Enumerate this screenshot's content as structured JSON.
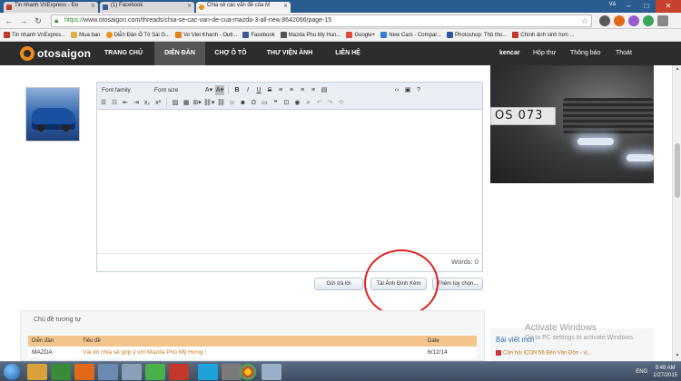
{
  "browser": {
    "tabs": [
      {
        "label": "Tin nhanh VnExpress - Đọ",
        "favicon_color": "#c0392b",
        "active": false
      },
      {
        "label": "(1) Facebook",
        "favicon_color": "#3b5998",
        "active": false
      },
      {
        "label": "Chia sẻ các vấn đề của M",
        "favicon_color": "#f08b1a",
        "active": true
      }
    ],
    "user_label": "Vá",
    "url_scheme": "https://",
    "url_rest": "www.otosaigon.com/threads/chia-se-cac-van-de-cua-mazda-3-all-new.8642066/page-15",
    "bookmarks": [
      {
        "label": "Tin nhanh VnExpres...",
        "color": "#c0392b"
      },
      {
        "label": "Mua ban",
        "color": "#e0b04a"
      },
      {
        "label": "Diễn Đàn Ô Tô Sài G...",
        "color": "#f08b1a"
      },
      {
        "label": "Vo Viet Khanh - Outl...",
        "color": "#e67e22"
      },
      {
        "label": "Facebook",
        "color": "#3b5998"
      },
      {
        "label": "Mazda Phu My Hun...",
        "color": "#555555"
      },
      {
        "label": "Google+",
        "color": "#dd4b39"
      },
      {
        "label": "New Cars - Compar...",
        "color": "#3a7bd5"
      },
      {
        "label": "Photoshop: Thủ thu...",
        "color": "#2c5aa0"
      },
      {
        "label": "Chính ảnh sinh hơn ...",
        "color": "#c0392b"
      }
    ]
  },
  "site": {
    "logo_text": "otosaigon",
    "nav": [
      "TRANG CHỦ",
      "DIỄN ĐÀN",
      "CHỢ Ô TÔ",
      "THƯ VIỆN ẢNH",
      "LIÊN HỆ"
    ],
    "active_nav": "DIỄN ĐÀN",
    "username": "kencar",
    "inbox": "Hộp thư",
    "alerts": "Thông báo",
    "logout": "Thoát"
  },
  "editor": {
    "font_family": "Font family",
    "font_size": "Font size",
    "words_label": "Words: 0"
  },
  "actions": {
    "reply": "Gửi trả lời",
    "attach": "Tải Ảnh Đính Kèm",
    "more": "Thêm tùy chọn..."
  },
  "similar": {
    "title": "Chủ đề tương tự",
    "headers": [
      "Diễn đàn",
      "Tiêu đề",
      "Date"
    ],
    "rows": [
      {
        "forum": "MAZDA",
        "title": "Vài lời chia sẻ góp ý với Mazda Phú Mỹ Hưng !",
        "date": "6/12/14"
      }
    ]
  },
  "sidebar": {
    "plate_text": "OS 073",
    "list_header": "Bài viết mới",
    "list_item": "Cần hỏi ICON 56 Bến Vân Đồn - vị..."
  },
  "watermark": {
    "line1": "Activate Windows",
    "line2": "Go to PC settings to activate Windows."
  },
  "taskbar": {
    "lang": "ENG",
    "time": "9:49 AM",
    "date": "1/27/2015"
  }
}
